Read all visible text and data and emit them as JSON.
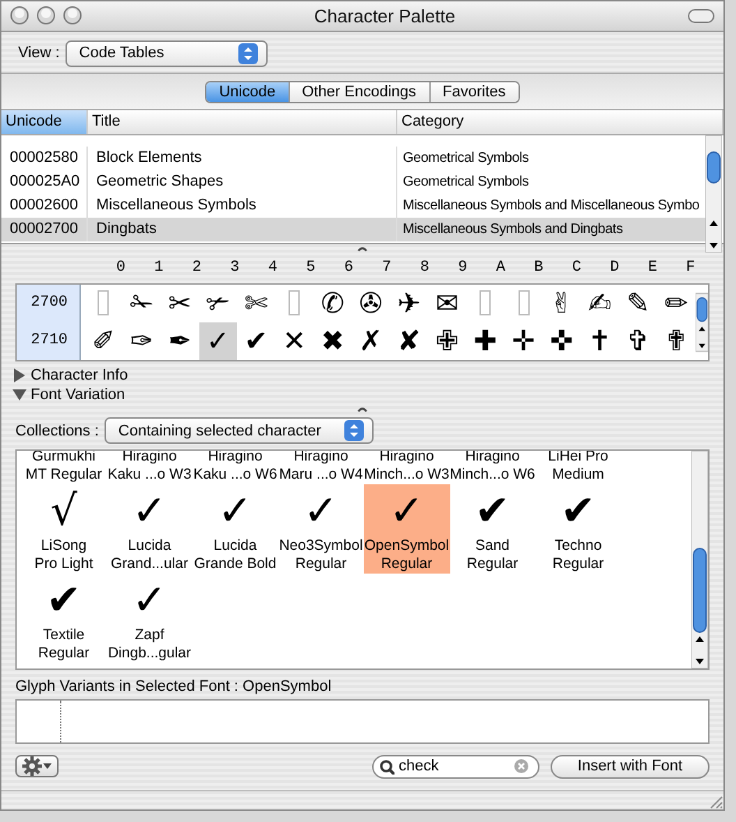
{
  "window": {
    "title": "Character Palette"
  },
  "view": {
    "label": "View :",
    "value": "Code Tables"
  },
  "tabs": [
    {
      "label": "Unicode",
      "selected": true
    },
    {
      "label": "Other Encodings",
      "selected": false
    },
    {
      "label": "Favorites",
      "selected": false
    }
  ],
  "table": {
    "columns": [
      {
        "label": "Unicode",
        "selected": true
      },
      {
        "label": "Title",
        "selected": false
      },
      {
        "label": "Category",
        "selected": false
      }
    ],
    "rows": [
      {
        "cells": [
          "00002580",
          "Block Elements",
          "Geometrical Symbols"
        ],
        "selected": false
      },
      {
        "cells": [
          "000025A0",
          "Geometric Shapes",
          "Geometrical Symbols"
        ],
        "selected": false
      },
      {
        "cells": [
          "00002600",
          "Miscellaneous Symbols",
          "Miscellaneous Symbols and Miscellaneous Symbo"
        ],
        "selected": false
      },
      {
        "cells": [
          "00002700",
          "Dingbats",
          "Miscellaneous Symbols and Dingbats"
        ],
        "selected": true
      }
    ]
  },
  "grid": {
    "columns": [
      "0",
      "1",
      "2",
      "3",
      "4",
      "5",
      "6",
      "7",
      "8",
      "9",
      "A",
      "B",
      "C",
      "D",
      "E",
      "F"
    ],
    "rows": [
      {
        "label": "2700",
        "cells": [
          {
            "kind": "missing",
            "selected": false
          },
          {
            "kind": "glyph",
            "char": "✁",
            "selected": false
          },
          {
            "kind": "glyph",
            "char": "✂",
            "selected": false
          },
          {
            "kind": "glyph",
            "char": "✃",
            "selected": false
          },
          {
            "kind": "glyph",
            "char": "✄",
            "selected": false
          },
          {
            "kind": "missing",
            "selected": false
          },
          {
            "kind": "glyph",
            "char": "✆",
            "selected": false
          },
          {
            "kind": "glyph",
            "char": "✇",
            "selected": false
          },
          {
            "kind": "glyph",
            "char": "✈",
            "selected": false
          },
          {
            "kind": "glyph",
            "char": "✉",
            "selected": false
          },
          {
            "kind": "missing",
            "selected": false
          },
          {
            "kind": "missing",
            "selected": false
          },
          {
            "kind": "glyph",
            "char": "✌",
            "selected": false
          },
          {
            "kind": "glyph",
            "char": "✍",
            "selected": false
          },
          {
            "kind": "glyph",
            "char": "✎",
            "selected": false
          },
          {
            "kind": "glyph",
            "char": "✏",
            "selected": false
          }
        ]
      },
      {
        "label": "2710",
        "cells": [
          {
            "kind": "glyph",
            "char": "✐",
            "selected": false
          },
          {
            "kind": "glyph",
            "char": "✑",
            "selected": false
          },
          {
            "kind": "glyph",
            "char": "✒",
            "selected": false
          },
          {
            "kind": "glyph",
            "char": "✓",
            "selected": true
          },
          {
            "kind": "glyph",
            "char": "✔",
            "selected": false
          },
          {
            "kind": "glyph",
            "char": "✕",
            "selected": false
          },
          {
            "kind": "glyph",
            "char": "✖",
            "selected": false
          },
          {
            "kind": "glyph",
            "char": "✗",
            "selected": false
          },
          {
            "kind": "glyph",
            "char": "✘",
            "selected": false
          },
          {
            "kind": "glyph",
            "char": "✙",
            "selected": false
          },
          {
            "kind": "glyph",
            "char": "✚",
            "selected": false
          },
          {
            "kind": "glyph",
            "char": "✛",
            "selected": false
          },
          {
            "kind": "glyph",
            "char": "✜",
            "selected": false
          },
          {
            "kind": "glyph",
            "char": "✝",
            "selected": false
          },
          {
            "kind": "glyph",
            "char": "✞",
            "selected": false
          },
          {
            "kind": "glyph",
            "char": "✟",
            "selected": false
          }
        ]
      }
    ]
  },
  "disclosures": [
    {
      "label": "Character Info",
      "expanded": false
    },
    {
      "label": "Font Variation",
      "expanded": true
    }
  ],
  "collections": {
    "label": "Collections :",
    "value": "Containing selected character"
  },
  "fonts": [
    {
      "name": "Gurmukhi\nMT Regular",
      "selected": false
    },
    {
      "name": "Hiragino\nKaku ...o W3",
      "selected": false
    },
    {
      "name": "Hiragino\nKaku ...o W6",
      "selected": false
    },
    {
      "name": "Hiragino\nMaru ...o W4",
      "selected": false
    },
    {
      "name": "Hiragino\nMinch...o W3",
      "selected": false
    },
    {
      "name": "Hiragino\nMinch...o W6",
      "selected": false
    },
    {
      "name": "LiHei Pro\nMedium",
      "selected": false
    },
    {
      "glyph": "√",
      "name": "LiSong\nPro Light",
      "selected": false
    },
    {
      "glyph": "✓",
      "name": "Lucida\nGrand...ular",
      "selected": false
    },
    {
      "glyph": "✓",
      "name": "Lucida\nGrande Bold",
      "selected": false
    },
    {
      "glyph": "✓",
      "name": "Neo3Symbol\nRegular",
      "selected": false
    },
    {
      "glyph": "✓",
      "name": "OpenSymbol\nRegular",
      "selected": true
    },
    {
      "glyph": "✔",
      "name": "Sand\nRegular",
      "selected": false
    },
    {
      "glyph": "✔",
      "name": "Techno\nRegular",
      "selected": false
    },
    {
      "glyph": "✔",
      "name": "Textile\nRegular",
      "selected": false
    },
    {
      "glyph": "✓",
      "name": "Zapf\nDingb...gular",
      "selected": false
    }
  ],
  "glyph_variants": {
    "label": "Glyph Variants in Selected Font : OpenSymbol"
  },
  "search": {
    "value": "check"
  },
  "insert_button": "Insert with Font"
}
